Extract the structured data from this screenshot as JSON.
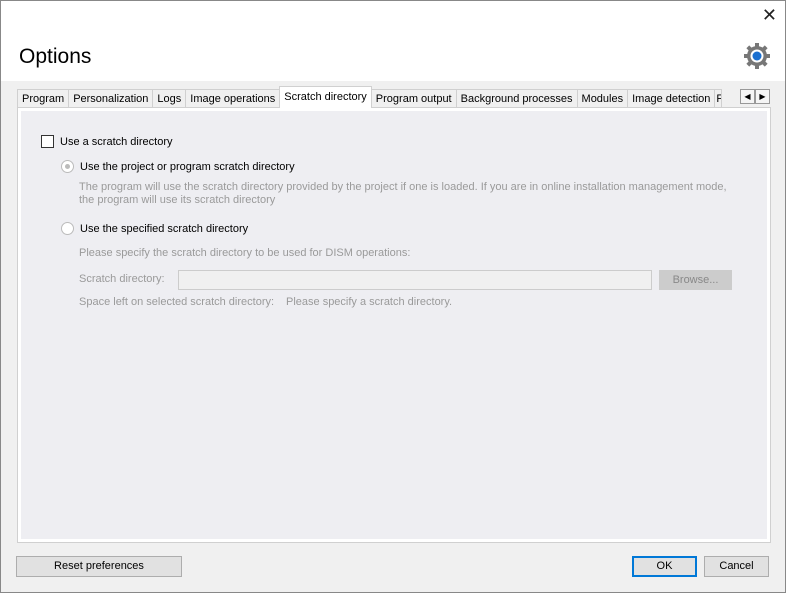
{
  "window": {
    "title": "Options"
  },
  "tabs": [
    {
      "label": "Program"
    },
    {
      "label": "Personalization"
    },
    {
      "label": "Logs"
    },
    {
      "label": "Image operations"
    },
    {
      "label": "Scratch directory",
      "active": true
    },
    {
      "label": "Program output"
    },
    {
      "label": "Background processes"
    },
    {
      "label": "Modules"
    },
    {
      "label": "Image detection"
    },
    {
      "label": "F"
    }
  ],
  "scratch": {
    "use_scratch_label": "Use a scratch directory",
    "use_scratch_checked": false,
    "option1_label": "Use the project or program scratch directory",
    "option1_selected": true,
    "option1_desc1": "The program will use the scratch directory provided by the project if one is loaded. If you are in online installation management mode,",
    "option1_desc2": "the program will use its scratch directory",
    "option2_label": "Use the specified scratch directory",
    "option2_selected": false,
    "specify_text": "Please specify the scratch directory to be used for DISM operations:",
    "dir_label": "Scratch directory:",
    "dir_value": "",
    "browse_label": "Browse...",
    "space_label": "Space left on selected scratch directory:",
    "space_value": "Please specify a scratch directory."
  },
  "footer": {
    "reset_label": "Reset preferences",
    "ok_label": "OK",
    "cancel_label": "Cancel"
  },
  "colors": {
    "accent": "#0078d7"
  }
}
